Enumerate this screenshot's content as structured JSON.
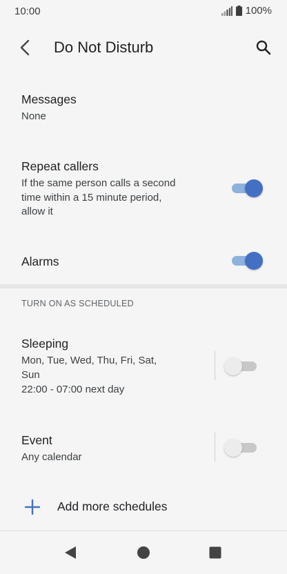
{
  "status_bar": {
    "time": "10:00",
    "battery": "100%",
    "signal_icon": "signal-icon",
    "battery_icon": "battery-icon"
  },
  "app_bar": {
    "title": "Do Not Disturb",
    "back_icon": "back-arrow-icon",
    "search_icon": "search-icon"
  },
  "settings": {
    "messages": {
      "title": "Messages",
      "subtitle": "None"
    },
    "repeat_callers": {
      "title": "Repeat callers",
      "subtitle_line1": "If the same person calls a second",
      "subtitle_line2": "time within a 15 minute period,",
      "subtitle_line3": "allow it",
      "enabled": true
    },
    "alarms": {
      "title": "Alarms",
      "enabled": true
    }
  },
  "schedules": {
    "header": "TURN ON AS SCHEDULED",
    "items": [
      {
        "title": "Sleeping",
        "days_line1": "Mon, Tue, Wed, Thu, Fri, Sat,",
        "days_line2": "Sun",
        "time": "22:00 - 07:00 next day",
        "enabled": false
      },
      {
        "title": "Event",
        "subtitle": "Any calendar",
        "enabled": false
      }
    ],
    "add_label": "Add more schedules"
  },
  "nav_bar": {
    "back": "nav-back-icon",
    "home": "nav-home-icon",
    "recents": "nav-recents-icon"
  },
  "colors": {
    "accent": "#4470c4",
    "accent_track": "#8db2dc",
    "off_track": "#c8c8c8",
    "background": "#f5f5f5"
  }
}
